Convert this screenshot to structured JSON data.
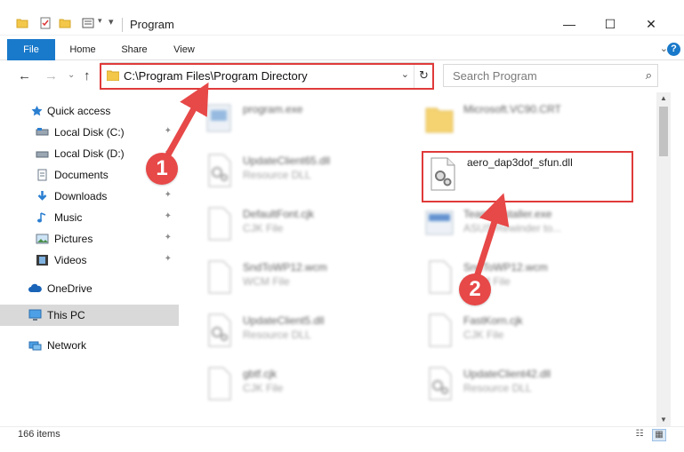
{
  "window": {
    "title": "Program",
    "minimize": "—",
    "maximize": "☐",
    "close": "✕"
  },
  "ribbon": {
    "tabs": [
      "File",
      "Home",
      "Share",
      "View"
    ],
    "expand_chevron": "⌄",
    "help": "?"
  },
  "nav": {
    "back": "←",
    "forward": "→",
    "recent": "⌄",
    "up": "↑",
    "address": "C:\\Program Files\\Program Directory",
    "address_dropdown": "⌄",
    "refresh": "↻",
    "search_placeholder": "Search Program",
    "search_icon": "⌕"
  },
  "sidebar": {
    "items": [
      {
        "label": "Quick access",
        "icon": "star-icon",
        "pinned": false
      },
      {
        "label": "Local Disk (C:)",
        "icon": "drive-icon",
        "pinned": true
      },
      {
        "label": "Local Disk (D:)",
        "icon": "drive-icon",
        "pinned": true
      },
      {
        "label": "Documents",
        "icon": "documents-icon",
        "pinned": true
      },
      {
        "label": "Downloads",
        "icon": "download-icon",
        "pinned": true
      },
      {
        "label": "Music",
        "icon": "music-icon",
        "pinned": true
      },
      {
        "label": "Pictures",
        "icon": "pictures-icon",
        "pinned": true
      },
      {
        "label": "Videos",
        "icon": "videos-icon",
        "pinned": true
      },
      {
        "label": "OneDrive",
        "icon": "cloud-icon",
        "pinned": false
      },
      {
        "label": "This PC",
        "icon": "computer-icon",
        "pinned": false,
        "selected": true
      },
      {
        "label": "Network",
        "icon": "network-icon",
        "pinned": false
      }
    ],
    "pin_glyph": "📌"
  },
  "files": [
    {
      "name": "program.exe",
      "type": "",
      "icon": "exe-icon"
    },
    {
      "name": "Microsoft.VC90.CRT",
      "type": "",
      "icon": "folder-icon"
    },
    {
      "name": "UpdateClient65.dll",
      "type": "Resource DLL",
      "icon": "dll-icon"
    },
    {
      "name": "aero_dap3dof_sfun.dll",
      "type": "",
      "icon": "dll-icon",
      "highlighted": true
    },
    {
      "name": "DefaultFont.cjk",
      "type": "CJK File",
      "icon": "file-icon"
    },
    {
      "name": "TeamsInstaller.exe",
      "type": "ASUS Rewinder to...",
      "icon": "exe-icon"
    },
    {
      "name": "SndToWP12.wcm",
      "type": "WCM File",
      "icon": "file-icon"
    },
    {
      "name": "SndToWP12.wcm",
      "type": "WCM File",
      "icon": "file-icon"
    },
    {
      "name": "UpdateClient5.dll",
      "type": "Resource DLL",
      "icon": "dll-icon"
    },
    {
      "name": "FastKorn.cjk",
      "type": "CJK File",
      "icon": "file-icon"
    },
    {
      "name": "gbtf.cjk",
      "type": "CJK File",
      "icon": "file-icon"
    },
    {
      "name": "UpdateClient42.dll",
      "type": "Resource DLL",
      "icon": "dll-icon"
    }
  ],
  "status": {
    "items": "166 items"
  },
  "annotations": {
    "badge1": "1",
    "badge2": "2",
    "color": "#e74848"
  },
  "colors": {
    "accent": "#1979ca",
    "selected_bg": "#d9d9d9",
    "annotation_red": "#e03a3a"
  }
}
